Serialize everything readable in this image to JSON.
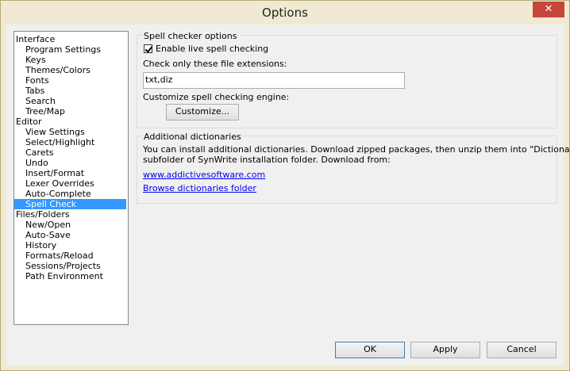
{
  "window": {
    "title": "Options",
    "close_glyph": "✕"
  },
  "tree": {
    "items": [
      {
        "label": "Interface",
        "level": 0
      },
      {
        "label": "Program Settings",
        "level": 1
      },
      {
        "label": "Keys",
        "level": 1
      },
      {
        "label": "Themes/Colors",
        "level": 1
      },
      {
        "label": "Fonts",
        "level": 1
      },
      {
        "label": "Tabs",
        "level": 1
      },
      {
        "label": "Search",
        "level": 1
      },
      {
        "label": "Tree/Map",
        "level": 1
      },
      {
        "label": "Editor",
        "level": 0
      },
      {
        "label": "View Settings",
        "level": 1
      },
      {
        "label": "Select/Highlight",
        "level": 1
      },
      {
        "label": "Carets",
        "level": 1
      },
      {
        "label": "Undo",
        "level": 1
      },
      {
        "label": "Insert/Format",
        "level": 1
      },
      {
        "label": "Lexer Overrides",
        "level": 1
      },
      {
        "label": "Auto-Complete",
        "level": 1
      },
      {
        "label": "Spell Check",
        "level": 1,
        "selected": true
      },
      {
        "label": "Files/Folders",
        "level": 0
      },
      {
        "label": "New/Open",
        "level": 1
      },
      {
        "label": "Auto-Save",
        "level": 1
      },
      {
        "label": "History",
        "level": 1
      },
      {
        "label": "Formats/Reload",
        "level": 1
      },
      {
        "label": "Sessions/Projects",
        "level": 1
      },
      {
        "label": "Path Environment",
        "level": 1
      }
    ]
  },
  "spell": {
    "group_title": "Spell checker options",
    "live_check_label": "Enable live spell checking",
    "live_check_checked": true,
    "extensions_label": "Check only these file extensions:",
    "extensions_value": "txt,diz",
    "engine_label": "Customize spell checking engine:",
    "customize_button": "Customize..."
  },
  "dictionaries": {
    "group_title": "Additional dictionaries",
    "text_line1": "You can install additional dictionaries. Download zipped packages, then unzip them into \"Dictionaries\"",
    "text_line2": "subfolder of SynWrite installation folder. Download from:",
    "link_site": "www.addictivesoftware.com",
    "link_browse": "Browse dictionaries folder"
  },
  "buttons": {
    "ok": "OK",
    "apply": "Apply",
    "cancel": "Cancel"
  },
  "colors": {
    "selection": "#3399ff",
    "frame": "#f0ead2",
    "close": "#c7463a",
    "link": "#0000ee"
  }
}
